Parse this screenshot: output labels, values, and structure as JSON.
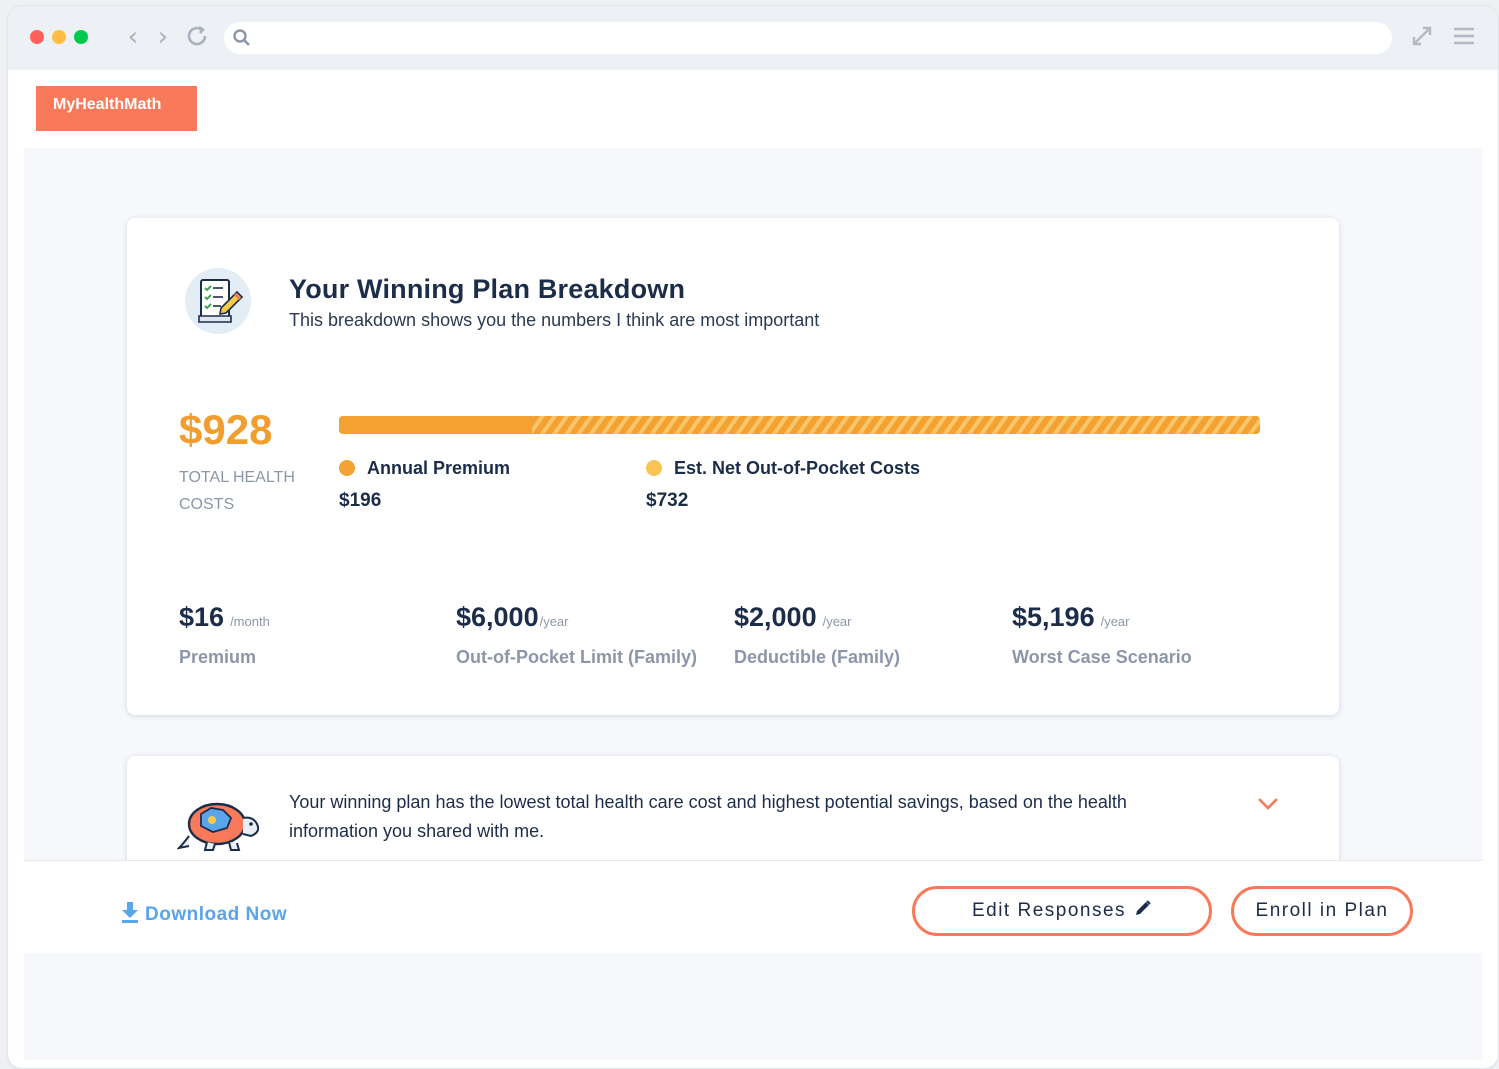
{
  "brand": {
    "name": "MyHealthMath"
  },
  "browser": {
    "url": ""
  },
  "breakdown": {
    "title": "Your Winning Plan Breakdown",
    "subtitle": "This breakdown shows you the numbers I think are most important",
    "total": "$928",
    "total_label": "TOTAL HEALTH COSTS",
    "bar": {
      "annual_premium_fraction": 0.21,
      "out_of_pocket_fraction": 0.79
    },
    "legend": [
      {
        "label": "Annual Premium",
        "value": "$196",
        "color": "#f3a232"
      },
      {
        "label": "Est. Net Out-of-Pocket Costs",
        "value": "$732",
        "color": "#f8c453"
      }
    ],
    "stats": [
      {
        "amount": "$16",
        "unit": "/month",
        "label": "Premium"
      },
      {
        "amount": "$6,000",
        "unit": "/year",
        "label": "Out-of-Pocket Limit (Family)"
      },
      {
        "amount": "$2,000",
        "unit": "/year",
        "label": "Deductible (Family)"
      },
      {
        "amount": "$5,196",
        "unit": "/year",
        "label": "Worst Case Scenario"
      }
    ]
  },
  "reason": {
    "message": "Your winning plan has the lowest total health care cost and highest potential savings, based on the health information you shared with me.",
    "expand_icon": "chevron-down-icon"
  },
  "footer": {
    "download_label": "Download Now",
    "edit_label": "Edit Responses",
    "enroll_label": "Enroll in Plan"
  },
  "colors": {
    "accent": "#f87a5a",
    "total": "#f29e2e",
    "link": "#5aa5ea",
    "heading": "#1c2d4a"
  }
}
